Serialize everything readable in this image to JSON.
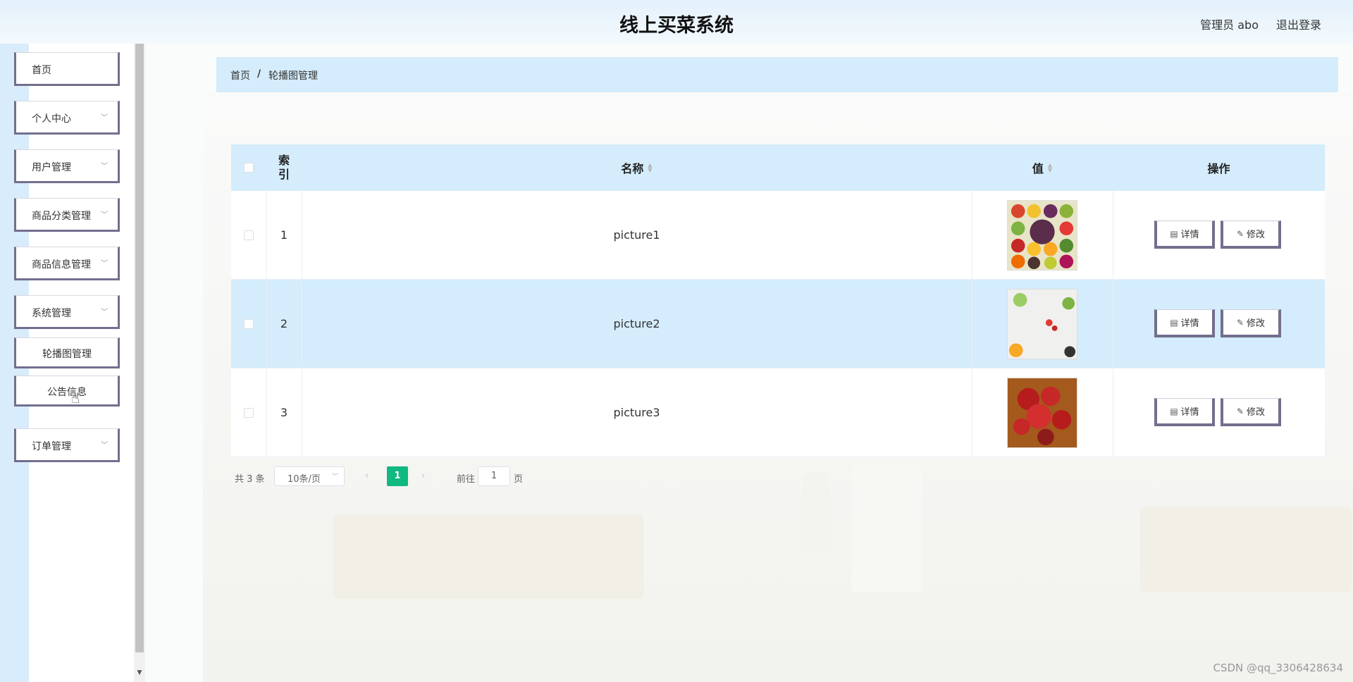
{
  "header": {
    "title": "线上买菜系统",
    "user": "管理员 abo",
    "logout": "退出登录"
  },
  "sidebar": {
    "items": [
      {
        "label": "首页",
        "expandable": false
      },
      {
        "label": "个人中心",
        "expandable": true
      },
      {
        "label": "用户管理",
        "expandable": true
      },
      {
        "label": "商品分类管理",
        "expandable": true
      },
      {
        "label": "商品信息管理",
        "expandable": true
      },
      {
        "label": "系统管理",
        "expandable": true
      },
      {
        "label": "订单管理",
        "expandable": true
      }
    ],
    "subitems": [
      {
        "label": "轮播图管理"
      },
      {
        "label": "公告信息"
      }
    ]
  },
  "breadcrumb": {
    "home": "首页",
    "separator": "/",
    "current": "轮播图管理"
  },
  "table": {
    "columns": {
      "index": "索引",
      "name": "名称",
      "value": "值",
      "actions": "操作"
    },
    "rows": [
      {
        "index": "1",
        "name": "picture1"
      },
      {
        "index": "2",
        "name": "picture2"
      },
      {
        "index": "3",
        "name": "picture3"
      }
    ],
    "actions": {
      "detail": "详情",
      "edit": "修改"
    }
  },
  "pagination": {
    "total": "共 3 条",
    "page_size": "10条/页",
    "current_page": "1",
    "goto_prefix": "前往",
    "goto_value": "1",
    "goto_suffix": "页"
  },
  "watermark": "CSDN @qq_3306428634",
  "colors": {
    "header_bg": "#e3f1fb",
    "accent_blue": "#d4ecfb",
    "pager_active": "#10b981",
    "button_border": "#726f8e"
  }
}
